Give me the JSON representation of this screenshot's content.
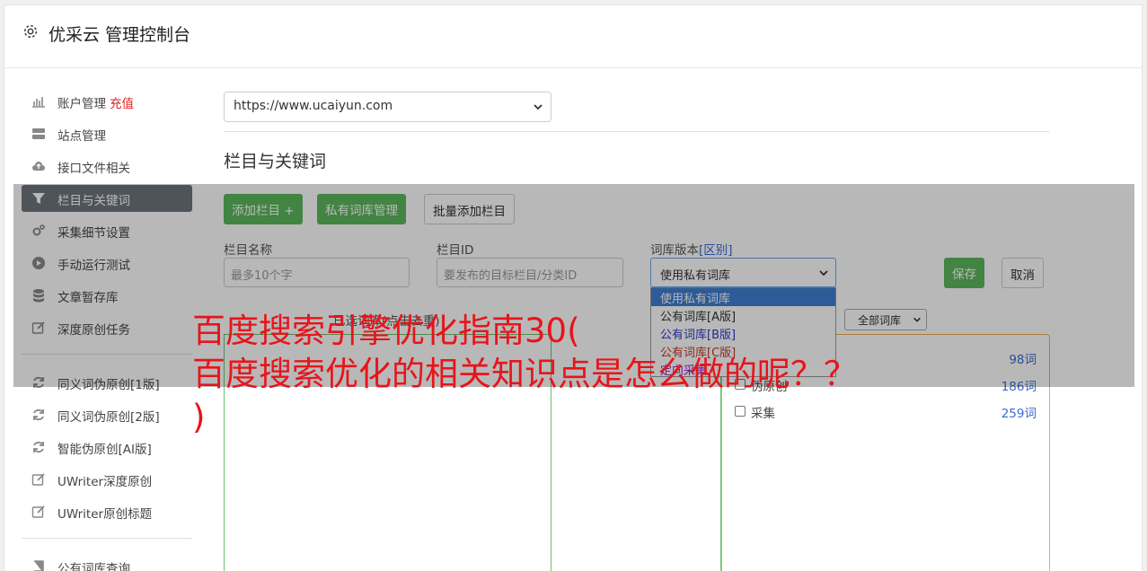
{
  "app": {
    "title": "优采云 管理控制台"
  },
  "sidebar": {
    "items": [
      {
        "label": "账户管理",
        "extra": "充值",
        "icon": "bar-chart-icon"
      },
      {
        "label": "站点管理",
        "icon": "server-icon"
      },
      {
        "label": "接口文件相关",
        "icon": "cloud-upload-icon"
      },
      {
        "label": "栏目与关键词",
        "icon": "filter-icon",
        "active": true
      },
      {
        "label": "采集细节设置",
        "icon": "gears-icon"
      },
      {
        "label": "手动运行测试",
        "icon": "play-circle-icon"
      },
      {
        "label": "文章暂存库",
        "icon": "database-icon"
      },
      {
        "label": "深度原创任务",
        "icon": "edit-icon"
      },
      {
        "label": "同义词伪原创[1版]",
        "icon": "refresh-icon"
      },
      {
        "label": "同义词伪原创[2版]",
        "icon": "refresh-icon"
      },
      {
        "label": "智能伪原创[AI版]",
        "icon": "refresh-icon"
      },
      {
        "label": "UWriter深度原创",
        "icon": "edit-icon"
      },
      {
        "label": "UWriter原创标题",
        "icon": "edit-icon"
      },
      {
        "label": "公有词库查询",
        "icon": "book-icon"
      }
    ]
  },
  "main": {
    "site_select": "https://www.ucaiyun.com",
    "section_title": "栏目与关键词",
    "buttons": {
      "add_column": "添加栏目 +",
      "private_lib": "私有词库管理",
      "batch_add": "批量添加栏目"
    },
    "form": {
      "name_label": "栏目名称",
      "name_placeholder": "最多10个字",
      "id_label": "栏目ID",
      "id_placeholder": "要发布的目标栏目/分类ID",
      "version_label": "词库版本",
      "version_link": "[区别]",
      "version_value": "使用私有词库",
      "save": "保存",
      "cancel": "取消"
    },
    "version_options": [
      {
        "label": "使用私有词库",
        "color": "#ffffff",
        "selected": true
      },
      {
        "label": "公有词库[A版]",
        "color": "#333333"
      },
      {
        "label": "公有词库[B版]",
        "color": "#2d38c8"
      },
      {
        "label": "公有词库[C版]",
        "color": "#c0392b"
      },
      {
        "label": "定向采集",
        "color": "#8e2bd6"
      }
    ],
    "selected_label": "已选词库(点击去重)",
    "filter_select": "全部词库",
    "libraries": [
      {
        "name": "",
        "count": "98词"
      },
      {
        "name": "伪原创",
        "count": "186词"
      },
      {
        "name": "采集",
        "count": "259词"
      }
    ]
  },
  "caption": {
    "line1": "百度搜索引擎优化指南30(",
    "line2": "百度搜索优化的相关知识点是怎么做的呢？？",
    "line3": ")"
  }
}
